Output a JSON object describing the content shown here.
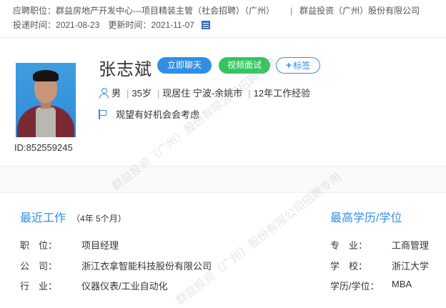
{
  "header": {
    "job_label": "应聘职位：",
    "job_value": "群益房地产开发中心---项目精装主管（社会招聘）（广州）",
    "separator": "|",
    "company": "群益投资（广州）股份有限公司",
    "delivered_label": "投递时间：",
    "delivered_value": "2021-08-23",
    "updated_label": "更新时间：",
    "updated_value": "2021-11-07"
  },
  "profile": {
    "name": "张志斌",
    "id_text": "ID:852559245",
    "chat_button": "立即聊天",
    "video_button": "视频面试",
    "tag_button": "标签",
    "gender": "男",
    "age": "35岁",
    "residence": "现居住 宁波-余姚市",
    "experience": "12年工作经验",
    "job_status": "观望有好机会会考虑"
  },
  "recent_work": {
    "title": "最近工作",
    "duration": "（4年 5个月）",
    "rows": [
      {
        "label": "职　位：",
        "value": "项目经理"
      },
      {
        "label": "公　司：",
        "value": "浙江衣拿智能科技股份有限公司"
      },
      {
        "label": "行　业：",
        "value": "仪器仪表/工业自动化"
      }
    ]
  },
  "education": {
    "title": "最高学历/学位",
    "rows": [
      {
        "label": "专　业：",
        "value": "工商管理"
      },
      {
        "label": "学　校：",
        "value": "浙江大学"
      },
      {
        "label": "学历/学位：",
        "value": "MBA"
      }
    ]
  },
  "watermark": {
    "text1": "群益投资（广州）股份有限公司招聘专用",
    "text2": "群益投资（广州）股份有限公司招聘专用"
  },
  "colors": {
    "accent": "#2f8fe5",
    "green": "#35c45f"
  }
}
